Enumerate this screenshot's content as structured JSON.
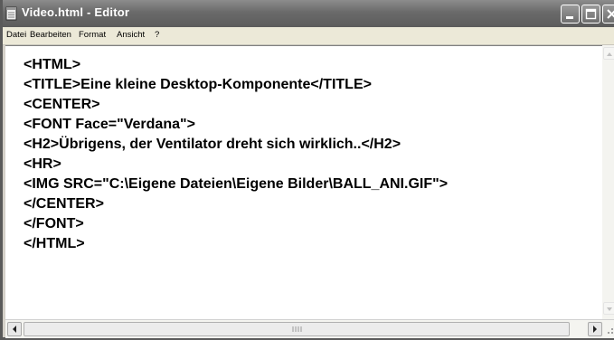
{
  "window": {
    "title": "Video.html - Editor",
    "colors": {
      "titlebar": "#6a6a6a",
      "title_text": "#ffffff",
      "editor_bg": "#ffffff"
    }
  },
  "icons": [
    "notepad-icon",
    "minimize-icon",
    "maximize-icon",
    "close-icon",
    "arrow-left-icon",
    "arrow-right-icon",
    "arrow-up-icon",
    "arrow-down-icon"
  ],
  "menu": {
    "items": [
      {
        "label": "Datei"
      },
      {
        "label": "Bearbeiten"
      },
      {
        "label": "Format"
      },
      {
        "label": "Ansicht"
      },
      {
        "label": "?"
      }
    ]
  },
  "editor": {
    "lines": [
      "<HTML>",
      "<TITLE>Eine kleine Desktop-Komponente</TITLE>",
      "<CENTER>",
      "<FONT Face=\"Verdana\">",
      "<H2>Übrigens, der Ventilator dreht sich wirklich..</H2>",
      "<HR>",
      "<IMG SRC=\"C:\\Eigene Dateien\\Eigene Bilder\\BALL_ANI.GIF\">",
      "</CENTER>",
      "</FONT>",
      "</HTML>"
    ]
  }
}
